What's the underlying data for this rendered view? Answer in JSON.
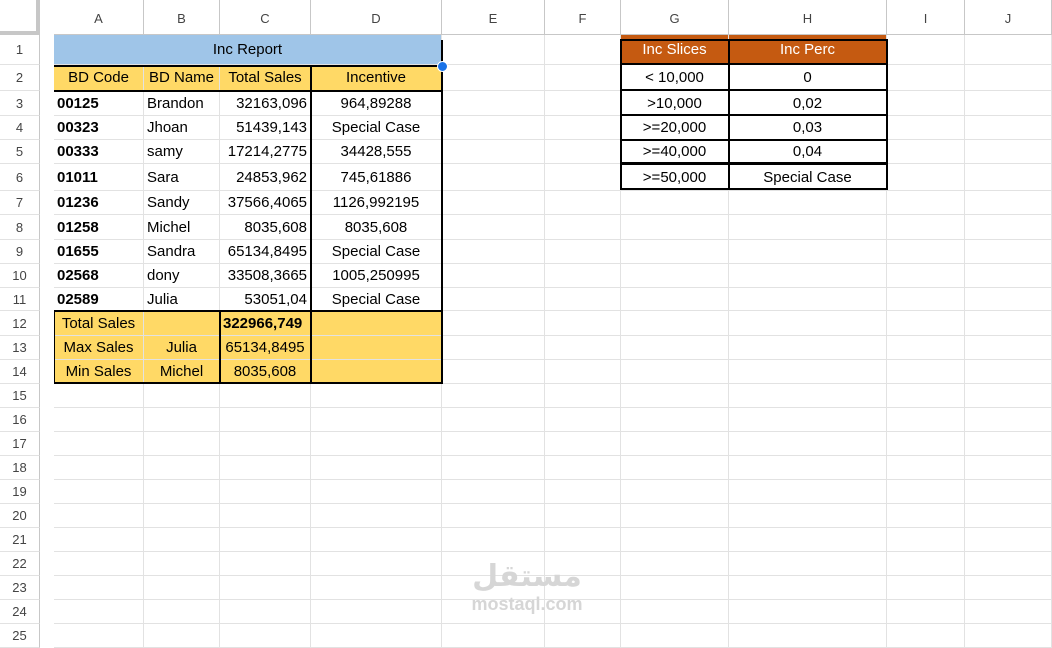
{
  "sheet": {
    "columns": [
      "A",
      "B",
      "C",
      "D",
      "E",
      "F",
      "G",
      "H",
      "I",
      "J"
    ],
    "rows": [
      "1",
      "2",
      "3",
      "4",
      "5",
      "6",
      "7",
      "8",
      "9",
      "10",
      "11",
      "12",
      "13",
      "14",
      "15",
      "16",
      "17",
      "18",
      "19",
      "20",
      "21",
      "22",
      "23",
      "24",
      "25"
    ]
  },
  "report": {
    "title": "Inc Report",
    "headers": [
      "BD Code",
      "BD Name",
      "Total Sales",
      "Incentive"
    ],
    "rows": [
      [
        "00125",
        "Brandon",
        "32163,096",
        "964,89288"
      ],
      [
        "00323",
        "Jhoan",
        "51439,143",
        "Special Case"
      ],
      [
        "00333",
        "samy",
        "17214,2775",
        "34428,555"
      ],
      [
        "01011",
        "Sara",
        "24853,962",
        "745,61886"
      ],
      [
        "01236",
        "Sandy",
        "37566,4065",
        "1126,992195"
      ],
      [
        "01258",
        "Michel",
        "8035,608",
        "8035,608"
      ],
      [
        "01655",
        "Sandra",
        "65134,8495",
        "Special Case"
      ],
      [
        "02568",
        "dony",
        "33508,3665",
        "1005,250995"
      ],
      [
        "02589",
        "Julia",
        "53051,04",
        "Special Case"
      ]
    ],
    "summary": [
      [
        "Total Sales",
        "",
        "322966,749",
        ""
      ],
      [
        "Max Sales",
        "Julia",
        "65134,8495",
        ""
      ],
      [
        "Min Sales",
        "Michel",
        "8035,608",
        ""
      ]
    ]
  },
  "slices": {
    "headers": [
      "Inc Slices",
      "Inc Perc"
    ],
    "rows": [
      [
        "< 10,000",
        "0"
      ],
      [
        ">10,000",
        "0,02"
      ],
      [
        ">=20,000",
        "0,03"
      ],
      [
        ">=40,000",
        "0,04"
      ],
      [
        ">=50,000",
        "Special Case"
      ]
    ]
  },
  "watermark": {
    "arabic": "مستقل",
    "latin": "mostaql.com"
  },
  "colors": {
    "header_yellow": "#ffd966",
    "title_blue": "#9fc5e8",
    "slice_orange": "#c55a11",
    "selection": "#1a73e8"
  }
}
